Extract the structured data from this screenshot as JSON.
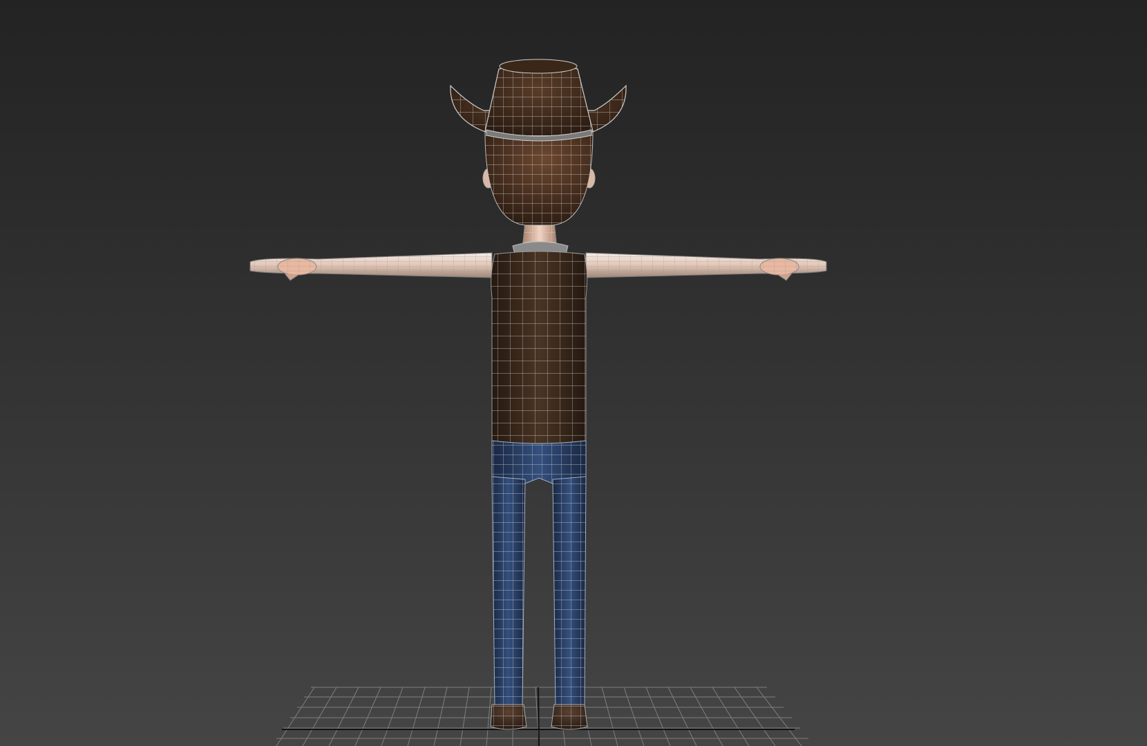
{
  "viewport": {
    "type": "3d-perspective-viewport",
    "view": "back",
    "shading": "smooth-shaded-with-wireframe-edges",
    "background_top": "#232323",
    "background_bottom": "#454545",
    "grid": true
  },
  "model": {
    "pose": "T-pose",
    "parts": [
      "hat",
      "head",
      "ears",
      "neck",
      "arms",
      "hands",
      "shirt",
      "pants",
      "boots"
    ],
    "colors": {
      "hat": "#3f2a1b",
      "hair": "#4a3222",
      "skin": "#e7c8b5",
      "shirt": "#3b2a1e",
      "pants": "#26385a",
      "boots": "#3c2c20",
      "wire": "#d7d7d7"
    }
  },
  "icons": {
    "grid": "ground-grid-icon"
  }
}
